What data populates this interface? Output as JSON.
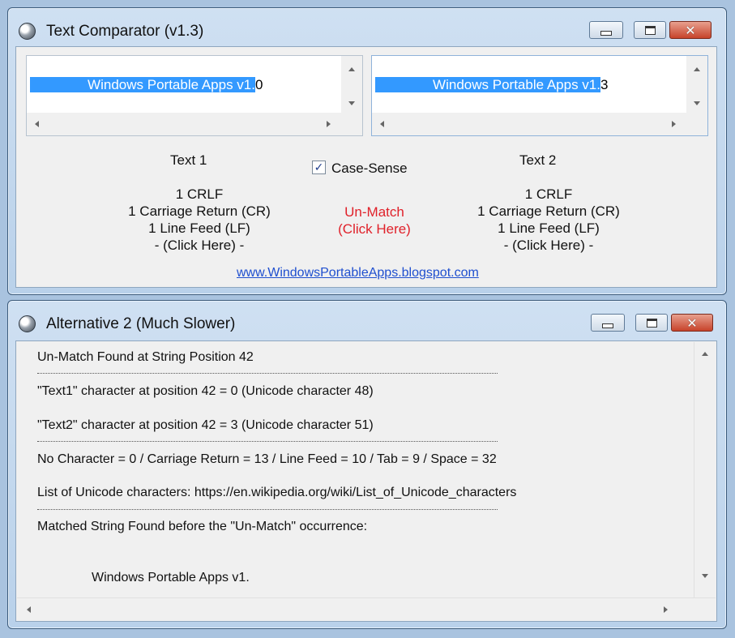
{
  "window1": {
    "title": "Text Comparator (v1.3)",
    "text1_box": {
      "selected_text": "Windows Portable Apps v1.",
      "rest_text": "0"
    },
    "text2_box": {
      "selected_text": "Windows Portable Apps v1.",
      "rest_text": "3"
    },
    "text1_label": "Text 1",
    "text2_label": "Text 2",
    "case_sense": {
      "label": "Case-Sense",
      "checked": true,
      "check_glyph": "✓"
    },
    "text1_stats": {
      "crlf": "1 CRLF",
      "cr": "1 Carriage Return (CR)",
      "lf": "1 Line Feed (LF)",
      "click": "- (Click Here) -"
    },
    "text2_stats": {
      "crlf": "1 CRLF",
      "cr": "1 Carriage Return (CR)",
      "lf": "1 Line Feed (LF)",
      "click": "- (Click Here) -"
    },
    "unmatch": {
      "line1": "Un-Match",
      "line2": "(Click Here)",
      "color": "#e0212a"
    },
    "website": "www.WindowsPortableApps.blogspot.com"
  },
  "window2": {
    "title": "Alternative 2 (Much Slower)",
    "lines": {
      "found": "Un-Match Found at String Position 42",
      "text1_char": "\"Text1\" character at position 42 = 0 (Unicode character 48)",
      "text2_char": "\"Text2\" character at position 42 = 3 (Unicode character 51)",
      "legend": "No Character = 0 / Carriage Return = 13 / Line Feed = 10 / Tab = 9 / Space = 32",
      "unicode_list": "List of Unicode characters: https://en.wikipedia.org/wiki/List_of_Unicode_characters",
      "matched_header": "Matched String Found before the \"Un-Match\" occurrence:",
      "matched_value": "Windows Portable Apps v1."
    }
  },
  "icons": {
    "close": "✕"
  },
  "colors": {
    "selection": "#3399ff",
    "link": "#1f4fcf",
    "unmatch": "#e0212a"
  }
}
